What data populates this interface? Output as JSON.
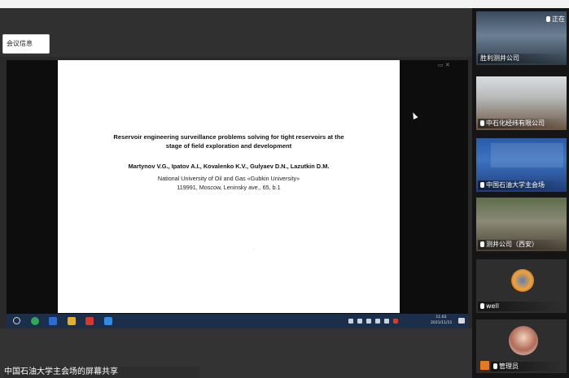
{
  "window": {
    "meeting_info_button": "会议信息"
  },
  "slide": {
    "title_line1": "Reservoir engineering surveillance problems solving for tight reservoirs at the",
    "title_line2": "stage of field exploration and development",
    "authors": "Martynov V.G., Ipatov A.I., Kovalenko K.V., Gulyaev D.N., Lazutkin D.M.",
    "affiliation_line1": "National University of Oil and Gas «Gubkin University»",
    "affiliation_line2": "119991, Moscow, Leninsky ave., 65, b.1"
  },
  "taskbar": {
    "time": "11:02",
    "date": "2021/11/11"
  },
  "share_caption": "中国石油大学主会场的屏幕共享",
  "participants": [
    {
      "name": "胜利测井公司",
      "status": "正在"
    },
    {
      "name": "中石化经纬有限公司"
    },
    {
      "name": "中国石油大学主会场"
    },
    {
      "name": "测井公司（西安）"
    },
    {
      "name": "well"
    },
    {
      "name": "管理员"
    }
  ],
  "colors": {
    "taskbar_bg": "#1b2f4a",
    "panel_bg": "#151515",
    "host_badge": "#e77a1e"
  }
}
